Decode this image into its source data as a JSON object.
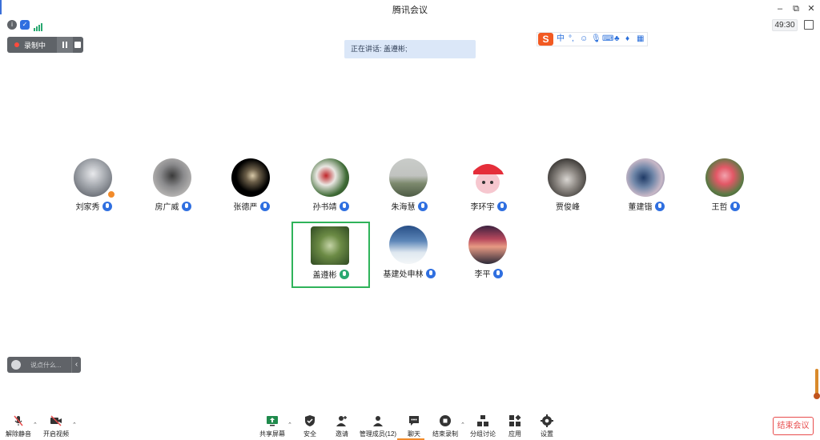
{
  "window": {
    "title": "腾讯会议"
  },
  "status": {
    "timer": "49:30"
  },
  "recording": {
    "label": "录制中"
  },
  "speaking_banner": "正在讲话: 盖遵彬;",
  "ime": {
    "logo": "S",
    "mode": "中",
    "punct": "°,"
  },
  "participants_row1": [
    {
      "name": "刘家秀",
      "mic": "blue"
    },
    {
      "name": "房广威",
      "mic": "blue"
    },
    {
      "name": "张德严",
      "mic": "blue"
    },
    {
      "name": "孙书靖",
      "mic": "blue"
    },
    {
      "name": "朱海慧",
      "mic": "blue"
    },
    {
      "name": "李环宇",
      "mic": "blue"
    },
    {
      "name": "贾俊峰",
      "mic": "none"
    },
    {
      "name": "董建锴",
      "mic": "blue"
    },
    {
      "name": "王哲",
      "mic": "blue"
    }
  ],
  "participants_row2": [
    {
      "name": "盖遵彬",
      "mic": "green"
    },
    {
      "name": "基建处申林",
      "mic": "blue"
    },
    {
      "name": "李平",
      "mic": "blue"
    }
  ],
  "chat": {
    "placeholder": "说点什么..."
  },
  "toolbar": {
    "unmute": "解除静音",
    "start_video": "开启视频",
    "share_screen": "共享屏幕",
    "security": "安全",
    "invite": "邀请",
    "manage_members": "管理成员(12)",
    "chat": "聊天",
    "end_recording": "结束录制",
    "breakout": "分组讨论",
    "apps": "应用",
    "settings": "设置",
    "end_meeting": "结束会议"
  },
  "colors": {
    "accent_blue": "#2f6fe0",
    "speaking_green": "#2fb35a",
    "end_red": "#e84d4d",
    "recording_red": "#ff4a3d"
  }
}
